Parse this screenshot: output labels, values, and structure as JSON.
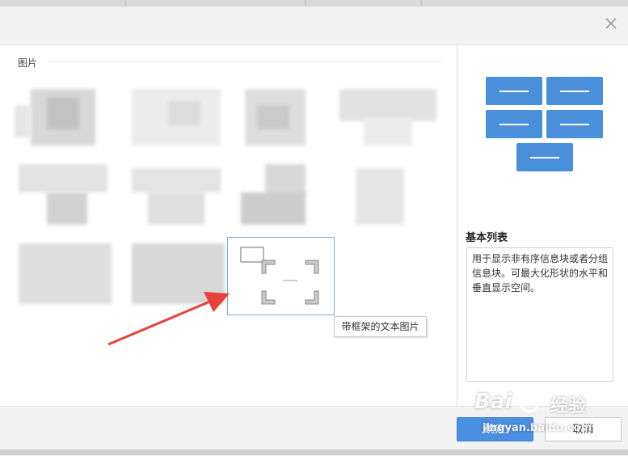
{
  "dialog": {
    "section_label": "图片",
    "tooltip": "带框架的文本图片",
    "close_icon": "close-icon"
  },
  "layout_preview": {
    "title": "基本列表",
    "description": "用于显示非有序信息块或者分组信息块。可最大化形状的水平和垂直显示空间。",
    "accent_color": "#4a8fd9"
  },
  "footer": {
    "ok_label": "确定",
    "cancel_label": "取消"
  },
  "watermark": {
    "logo_text": "Bai",
    "logo_text2": "经验",
    "url": "jingyan.baidu.com"
  },
  "colors": {
    "primary_button": "#4a8fe0",
    "annotation_arrow": "#e8403a",
    "selection_border": "#7fa7d8"
  }
}
